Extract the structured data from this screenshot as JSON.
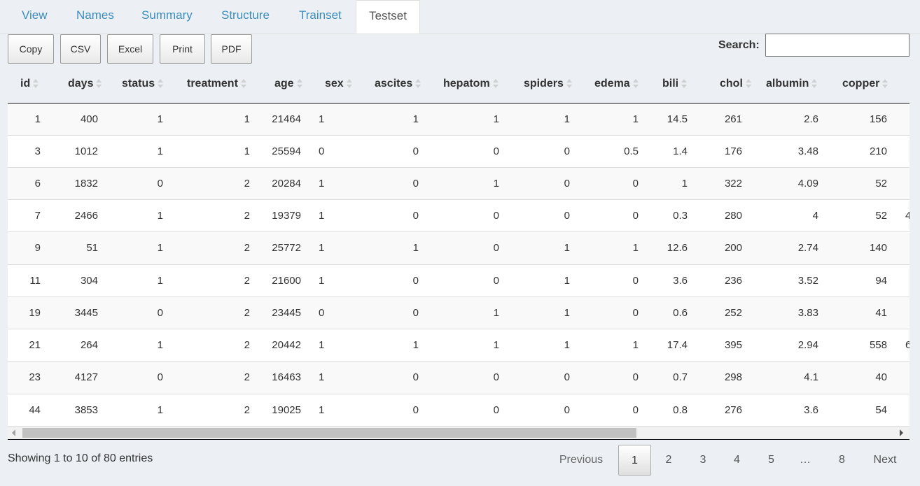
{
  "tabs": [
    "View",
    "Names",
    "Summary",
    "Structure",
    "Trainset",
    "Testset"
  ],
  "active_tab": "Testset",
  "buttons": [
    "Copy",
    "CSV",
    "Excel",
    "Print",
    "PDF"
  ],
  "search": {
    "label": "Search:",
    "value": ""
  },
  "table": {
    "columns": [
      "id",
      "days",
      "status",
      "treatment",
      "age",
      "sex",
      "ascites",
      "hepatom",
      "spiders",
      "edema",
      "bili",
      "chol",
      "albumin",
      "copper"
    ],
    "rows": [
      [
        "1",
        "400",
        "1",
        "1",
        "21464",
        "1",
        "1",
        "1",
        "1",
        "1",
        "14.5",
        "261",
        "2.6",
        "156"
      ],
      [
        "3",
        "1012",
        "1",
        "1",
        "25594",
        "0",
        "0",
        "0",
        "0",
        "0.5",
        "1.4",
        "176",
        "3.48",
        "210"
      ],
      [
        "6",
        "1832",
        "0",
        "2",
        "20284",
        "1",
        "0",
        "1",
        "0",
        "0",
        "1",
        "322",
        "4.09",
        "52"
      ],
      [
        "7",
        "2466",
        "1",
        "2",
        "19379",
        "1",
        "0",
        "0",
        "0",
        "0",
        "0.3",
        "280",
        "4",
        "52"
      ],
      [
        "9",
        "51",
        "1",
        "2",
        "25772",
        "1",
        "1",
        "0",
        "1",
        "1",
        "12.6",
        "200",
        "2.74",
        "140"
      ],
      [
        "11",
        "304",
        "1",
        "2",
        "21600",
        "1",
        "0",
        "0",
        "1",
        "0",
        "3.6",
        "236",
        "3.52",
        "94"
      ],
      [
        "19",
        "3445",
        "0",
        "2",
        "23445",
        "0",
        "0",
        "1",
        "1",
        "0",
        "0.6",
        "252",
        "3.83",
        "41"
      ],
      [
        "21",
        "264",
        "1",
        "2",
        "20442",
        "1",
        "1",
        "1",
        "1",
        "1",
        "17.4",
        "395",
        "2.94",
        "558"
      ],
      [
        "23",
        "4127",
        "0",
        "2",
        "16463",
        "1",
        "0",
        "0",
        "0",
        "0",
        "0.7",
        "298",
        "4.1",
        "40"
      ],
      [
        "44",
        "3853",
        "1",
        "2",
        "19025",
        "1",
        "0",
        "0",
        "0",
        "0",
        "0.8",
        "276",
        "3.6",
        "54"
      ]
    ],
    "overflow_column_partial": [
      "",
      "",
      "",
      "4",
      "",
      "",
      "",
      "6",
      "",
      ""
    ]
  },
  "footer": {
    "info": "Showing 1 to 10 of 80 entries",
    "previous": "Previous",
    "next": "Next",
    "pages": [
      "1",
      "2",
      "3",
      "4",
      "5",
      "…",
      "8"
    ],
    "current_page": "1"
  }
}
